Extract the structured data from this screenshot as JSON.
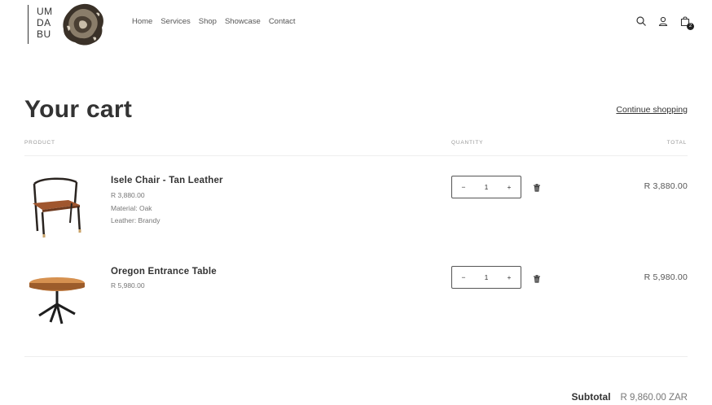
{
  "header": {
    "logo_lines": [
      "UM",
      "DA",
      "BU"
    ],
    "nav": [
      "Home",
      "Services",
      "Shop",
      "Showcase",
      "Contact"
    ],
    "cart_count": "2",
    "icons": [
      "search-icon",
      "account-icon",
      "cart-icon"
    ]
  },
  "cart": {
    "title": "Your cart",
    "continue_label": "Continue shopping",
    "headers": {
      "product": "Product",
      "quantity": "Quantity",
      "total": "Total"
    },
    "items": [
      {
        "name": "Isele Chair - Tan Leather",
        "price": "R 3,880.00",
        "meta": [
          "Material: Oak",
          "Leather: Brandy"
        ],
        "quantity": "1",
        "total": "R 3,880.00"
      },
      {
        "name": "Oregon Entrance Table",
        "price": "R 5,980.00",
        "meta": [],
        "quantity": "1",
        "total": "R 5,980.00"
      }
    ],
    "subtotal_label": "Subtotal",
    "subtotal_value": "R 9,860.00 ZAR"
  },
  "controls": {
    "minus": "−",
    "plus": "+"
  },
  "colors": {
    "text": "#333333",
    "muted": "#777777",
    "border": "#555555"
  }
}
